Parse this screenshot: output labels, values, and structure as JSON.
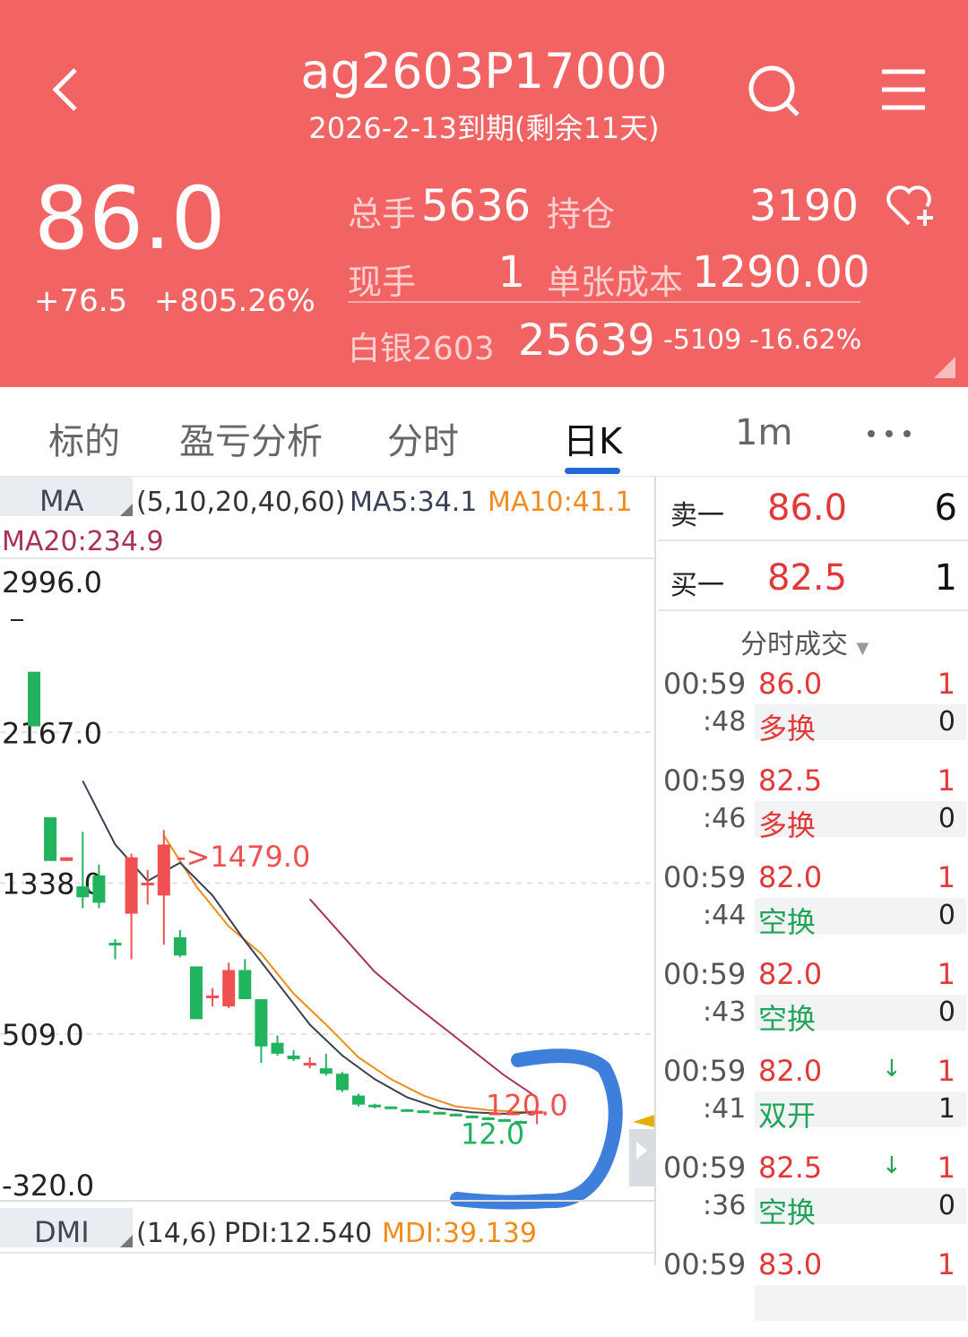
{
  "header": {
    "title": "ag2603P17000",
    "subtitle": "2026-2-13到期(剩余11天)",
    "price": "86.0",
    "change": "+76.5",
    "change_pct": "+805.26%",
    "total_volume_label": "总手",
    "total_volume": "5636",
    "open_interest_label": "持仓",
    "open_interest": "3190",
    "current_volume_label": "现手",
    "current_volume": "1",
    "unit_cost_label": "单张成本",
    "unit_cost": "1290.00",
    "underlying_label": "白银2603",
    "underlying_price": "25639",
    "underlying_change": "-5109",
    "underlying_change_pct": "-16.62%"
  },
  "tabs": [
    {
      "label": "标的"
    },
    {
      "label": "盈亏分析"
    },
    {
      "label": "分时"
    },
    {
      "label": "日K"
    },
    {
      "label": "1m"
    }
  ],
  "ma": {
    "name": "MA",
    "params": "(5,10,20,40,60)",
    "ma5": "MA5:34.1",
    "ma10": "MA10:41.1",
    "ma20": "MA20:234.9"
  },
  "dmi": {
    "name": "DMI",
    "params": "(14,6)",
    "pdi": "PDI:12.540",
    "mdi": "MDI:39.139"
  },
  "y_labels": [
    "2996.0",
    "2167.0",
    "1338.0",
    "509.0",
    "-320.0"
  ],
  "annotations": {
    "high": "->1479.0",
    "last": "120.0",
    "low": "12.0"
  },
  "colors": {
    "header": "#f26464",
    "up": "#f05050",
    "down": "#22b35e",
    "ma5": "#3a4056",
    "ma10": "#f08c1e",
    "ma20": "#a8325a",
    "accent": "#2468d8"
  },
  "orderbook": {
    "sell_label": "卖一",
    "sell_price": "86.0",
    "sell_qty": "6",
    "buy_label": "买一",
    "buy_price": "82.5",
    "buy_qty": "1"
  },
  "trades_title": "分时成交",
  "trades": [
    {
      "time": "00:59",
      "sec": ":48",
      "price": "86.0",
      "type": "多换",
      "qty": "1",
      "oi": "0",
      "arrow": "",
      "pcolor": "red",
      "tcolor": "red"
    },
    {
      "time": "00:59",
      "sec": ":46",
      "price": "82.5",
      "type": "多换",
      "qty": "1",
      "oi": "0",
      "arrow": "",
      "pcolor": "red",
      "tcolor": "red"
    },
    {
      "time": "00:59",
      "sec": ":44",
      "price": "82.0",
      "type": "空换",
      "qty": "1",
      "oi": "0",
      "arrow": "",
      "pcolor": "red",
      "tcolor": "green"
    },
    {
      "time": "00:59",
      "sec": ":43",
      "price": "82.0",
      "type": "空换",
      "qty": "1",
      "oi": "0",
      "arrow": "",
      "pcolor": "red",
      "tcolor": "green"
    },
    {
      "time": "00:59",
      "sec": ":41",
      "price": "82.0",
      "type": "双开",
      "qty": "1",
      "oi": "1",
      "arrow": "↓",
      "pcolor": "red",
      "tcolor": "green"
    },
    {
      "time": "00:59",
      "sec": ":36",
      "price": "82.5",
      "type": "空换",
      "qty": "1",
      "oi": "0",
      "arrow": "↓",
      "pcolor": "red",
      "tcolor": "green"
    },
    {
      "time": "00:59",
      "sec": "",
      "price": "83.0",
      "type": "",
      "qty": "1",
      "oi": "",
      "arrow": "",
      "pcolor": "red",
      "tcolor": "red"
    }
  ],
  "chart_data": {
    "type": "candlestick",
    "ylim": [
      -320,
      2996
    ],
    "y_ticks": [
      2996,
      2167,
      1338,
      509,
      -320
    ],
    "candles": [
      {
        "o": 2500,
        "c": 2200,
        "h": 2500,
        "l": 2200
      },
      {
        "o": 1700,
        "c": 1460,
        "h": 1700,
        "l": 1460
      },
      {
        "o": 1460,
        "c": 1480,
        "h": 1480,
        "l": 1460
      },
      {
        "o": 1320,
        "c": 1260,
        "h": 1620,
        "l": 1200
      },
      {
        "o": 1380,
        "c": 1230,
        "h": 1440,
        "l": 1200
      },
      {
        "o": 1010,
        "c": 1000,
        "h": 1030,
        "l": 920
      },
      {
        "o": 1170,
        "c": 1480,
        "h": 1500,
        "l": 920
      },
      {
        "o": 1330,
        "c": 1340,
        "h": 1410,
        "l": 1220
      },
      {
        "o": 1270,
        "c": 1550,
        "h": 1630,
        "l": 1000
      },
      {
        "o": 1040,
        "c": 940,
        "h": 1080,
        "l": 930
      },
      {
        "o": 880,
        "c": 590,
        "h": 880,
        "l": 590
      },
      {
        "o": 710,
        "c": 720,
        "h": 760,
        "l": 660
      },
      {
        "o": 660,
        "c": 860,
        "h": 900,
        "l": 650
      },
      {
        "o": 860,
        "c": 700,
        "h": 920,
        "l": 700
      },
      {
        "o": 700,
        "c": 440,
        "h": 700,
        "l": 350
      },
      {
        "o": 460,
        "c": 400,
        "h": 500,
        "l": 390
      },
      {
        "o": 390,
        "c": 370,
        "h": 420,
        "l": 360
      },
      {
        "o": 340,
        "c": 350,
        "h": 380,
        "l": 320
      },
      {
        "o": 320,
        "c": 290,
        "h": 400,
        "l": 280
      },
      {
        "o": 290,
        "c": 200,
        "h": 300,
        "l": 190
      },
      {
        "o": 170,
        "c": 120,
        "h": 180,
        "l": 110
      },
      {
        "o": 120,
        "c": 110,
        "h": 125,
        "l": 100
      },
      {
        "o": 110,
        "c": 100,
        "h": 110,
        "l": 95
      },
      {
        "o": 95,
        "c": 90,
        "h": 95,
        "l": 88
      },
      {
        "o": 88,
        "c": 84,
        "h": 90,
        "l": 82
      },
      {
        "o": 80,
        "c": 78,
        "h": 82,
        "l": 76
      },
      {
        "o": 70,
        "c": 68,
        "h": 72,
        "l": 66
      },
      {
        "o": 60,
        "c": 58,
        "h": 62,
        "l": 56
      },
      {
        "o": 50,
        "c": 48,
        "h": 52,
        "l": 46
      },
      {
        "o": 40,
        "c": 38,
        "h": 42,
        "l": 36
      },
      {
        "o": 30,
        "c": 28,
        "h": 32,
        "l": 26
      },
      {
        "o": 70,
        "c": 86,
        "h": 120,
        "l": 12
      }
    ],
    "ma5": [
      [
        3,
        1900
      ],
      [
        5,
        1550
      ],
      [
        7,
        1350
      ],
      [
        9,
        1450
      ],
      [
        11,
        1270
      ],
      [
        13,
        1020
      ],
      [
        15,
        790
      ],
      [
        17,
        560
      ],
      [
        19,
        390
      ],
      [
        21,
        260
      ],
      [
        23,
        160
      ],
      [
        25,
        100
      ],
      [
        27,
        78
      ],
      [
        29,
        70
      ],
      [
        31,
        80
      ]
    ],
    "ma10": [
      [
        8,
        1600
      ],
      [
        10,
        1320
      ],
      [
        12,
        1100
      ],
      [
        14,
        950
      ],
      [
        16,
        730
      ],
      [
        18,
        560
      ],
      [
        20,
        380
      ],
      [
        22,
        260
      ],
      [
        24,
        170
      ],
      [
        26,
        110
      ],
      [
        28,
        90
      ],
      [
        30,
        80
      ],
      [
        31,
        82
      ]
    ],
    "ma20": [
      [
        17,
        1250
      ],
      [
        19,
        1050
      ],
      [
        21,
        850
      ],
      [
        23,
        700
      ],
      [
        25,
        560
      ],
      [
        27,
        420
      ],
      [
        29,
        280
      ],
      [
        31,
        160
      ]
    ]
  }
}
